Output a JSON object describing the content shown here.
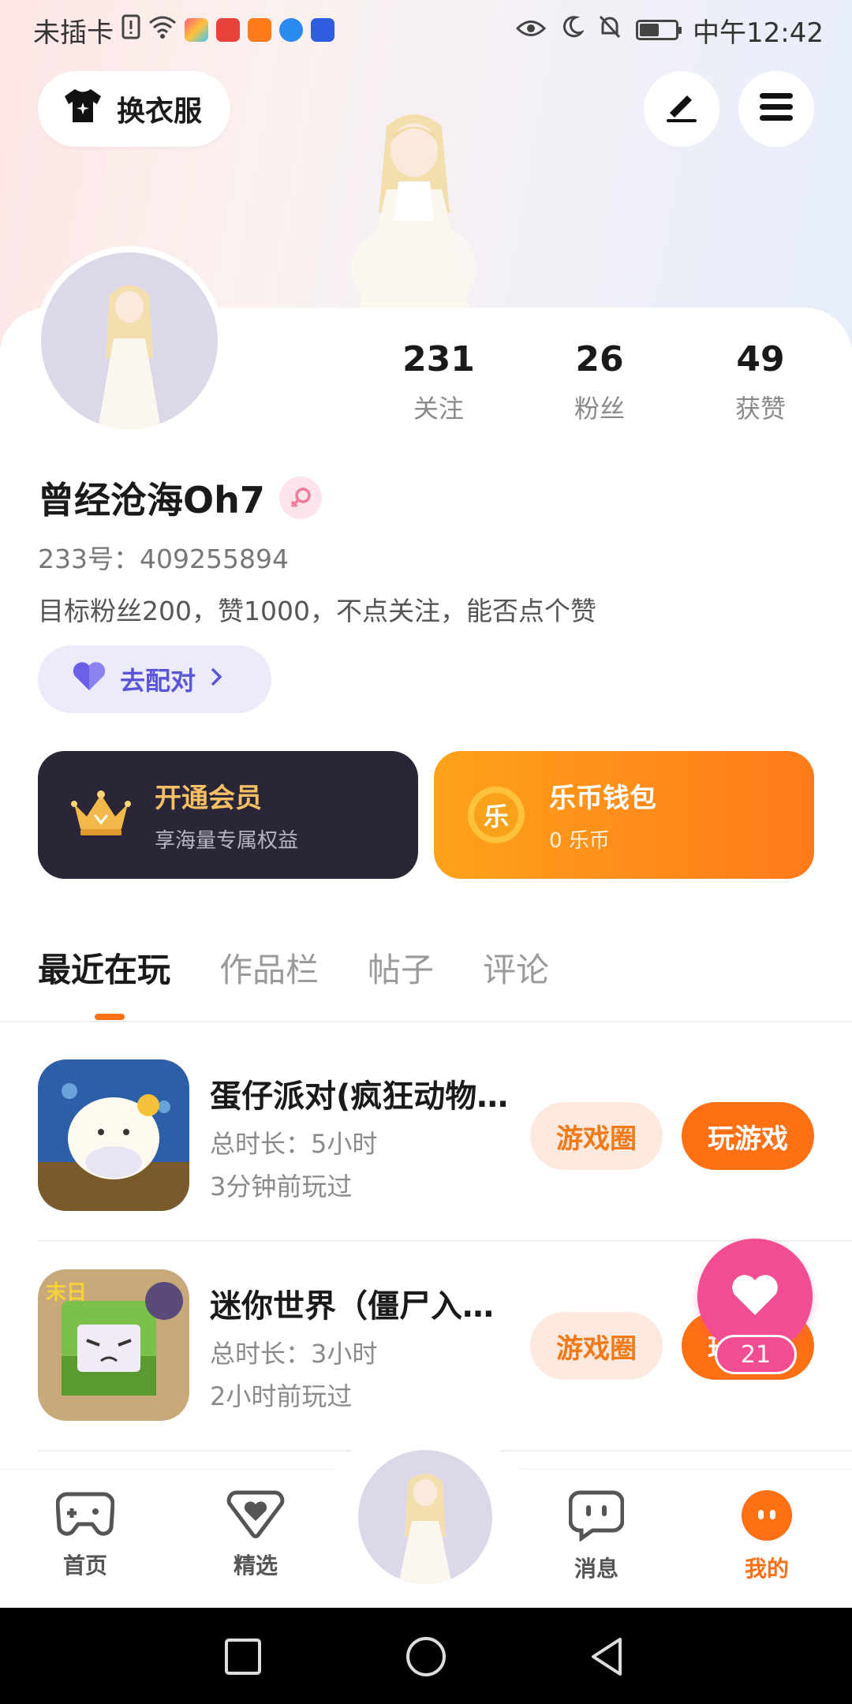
{
  "status_bar": {
    "carrier": "未插卡",
    "time": "中午12:42",
    "battery_level": 0.55
  },
  "header": {
    "outfit_label": "换衣服",
    "edit_icon": "pen-icon",
    "menu_icon": "menu-icon"
  },
  "profile": {
    "username": "曾经沧海Oh7",
    "id_line": "233号：409255894",
    "bio": "目标粉丝200，赞1000，不点关注，能否点个赞",
    "match_label": "去配对"
  },
  "stats": [
    {
      "value": "231",
      "label": "关注"
    },
    {
      "value": "26",
      "label": "粉丝"
    },
    {
      "value": "49",
      "label": "获赞"
    }
  ],
  "cards": {
    "vip": {
      "title": "开通会员",
      "subtitle": "享海量专属权益"
    },
    "wallet": {
      "title": "乐币钱包",
      "subtitle": "0 乐币",
      "coin_label": "乐"
    }
  },
  "tabs": [
    "最近在玩",
    "作品栏",
    "帖子",
    "评论"
  ],
  "games": [
    {
      "title": "蛋仔派对(疯狂动物…",
      "duration": "总时长：5小时",
      "last_played": "3分钟前玩过",
      "circle_label": "游戏圈",
      "play_label": "玩游戏"
    },
    {
      "title": "迷你世界（僵尸入…",
      "duration": "总时长：3小时",
      "last_played": "2小时前玩过",
      "circle_label": "游戏圈",
      "play_label": "玩游戏"
    }
  ],
  "floating_like": {
    "count": "21"
  },
  "bottom_nav": [
    {
      "label": "首页",
      "icon": "gamepad-icon"
    },
    {
      "label": "精选",
      "icon": "heart-badge-icon"
    },
    {
      "label": "消息",
      "icon": "chat-icon"
    },
    {
      "label": "我的",
      "icon": "profile-icon"
    }
  ],
  "colors": {
    "accent": "#ff6f14",
    "like_pink": "#f24d92",
    "match_purple": "#5b55d9",
    "vip_dark": "#2a2638"
  }
}
